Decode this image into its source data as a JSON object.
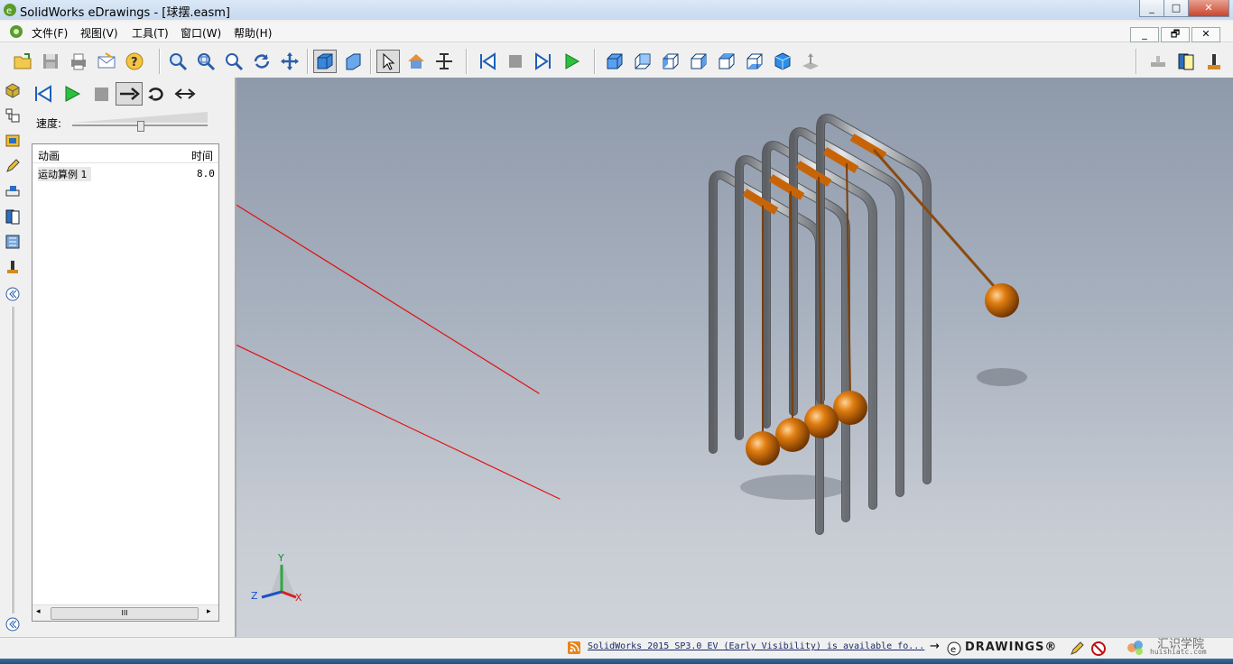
{
  "window": {
    "title": "SolidWorks eDrawings - [球摆.easm]",
    "min": "_",
    "max": "□",
    "close": "✕"
  },
  "mdi": {
    "min": "_",
    "restore": "🗗",
    "close": "✕"
  },
  "menu": [
    {
      "label": "文件(F)"
    },
    {
      "label": "视图(V)"
    },
    {
      "label": "工具(T)"
    },
    {
      "label": "窗口(W)"
    },
    {
      "label": "帮助(H)"
    }
  ],
  "toolbar": {
    "icons": [
      "open-icon",
      "save-icon",
      "print-icon",
      "email-icon",
      "help-icon",
      "zoom-fit-icon",
      "zoom-area-icon",
      "zoom-icon",
      "rotate-icon",
      "pan-icon",
      "shaded-icon",
      "perspective-icon",
      "select-icon",
      "home-icon",
      "measure-icon",
      "first-frame-icon",
      "stop-icon",
      "next-frame-icon",
      "play-icon",
      "view-front-icon",
      "view-back-icon",
      "view-left-icon",
      "view-right-icon",
      "view-top-icon",
      "view-bottom-icon",
      "view-iso-icon",
      "view-plane-icon",
      "stamp-icon",
      "markup-icon",
      "mass-icon"
    ]
  },
  "panel": {
    "speed_label": "速度:",
    "list": {
      "col_animation": "动画",
      "col_time": "时间",
      "rows": [
        {
          "name": "运动算例 1",
          "time": "8.0"
        }
      ]
    },
    "scroll_grip": "III"
  },
  "axes": {
    "x": "X",
    "y": "Y",
    "z": "Z"
  },
  "status": {
    "message": "SolidWorks 2015 SP3.0 EV (Early Visibility) is available fo...",
    "arrow": "→",
    "brand": "DRAWINGS®",
    "watermark_cn": "汇识学院",
    "watermark_url": "huishiatc.com"
  },
  "colors": {
    "accent_orange": "#e07d10",
    "frame_steel": "#9ca0a6",
    "annotation_red": "#e01010",
    "viewport_top": "#8e99aa",
    "viewport_bottom": "#cfd3d9"
  }
}
